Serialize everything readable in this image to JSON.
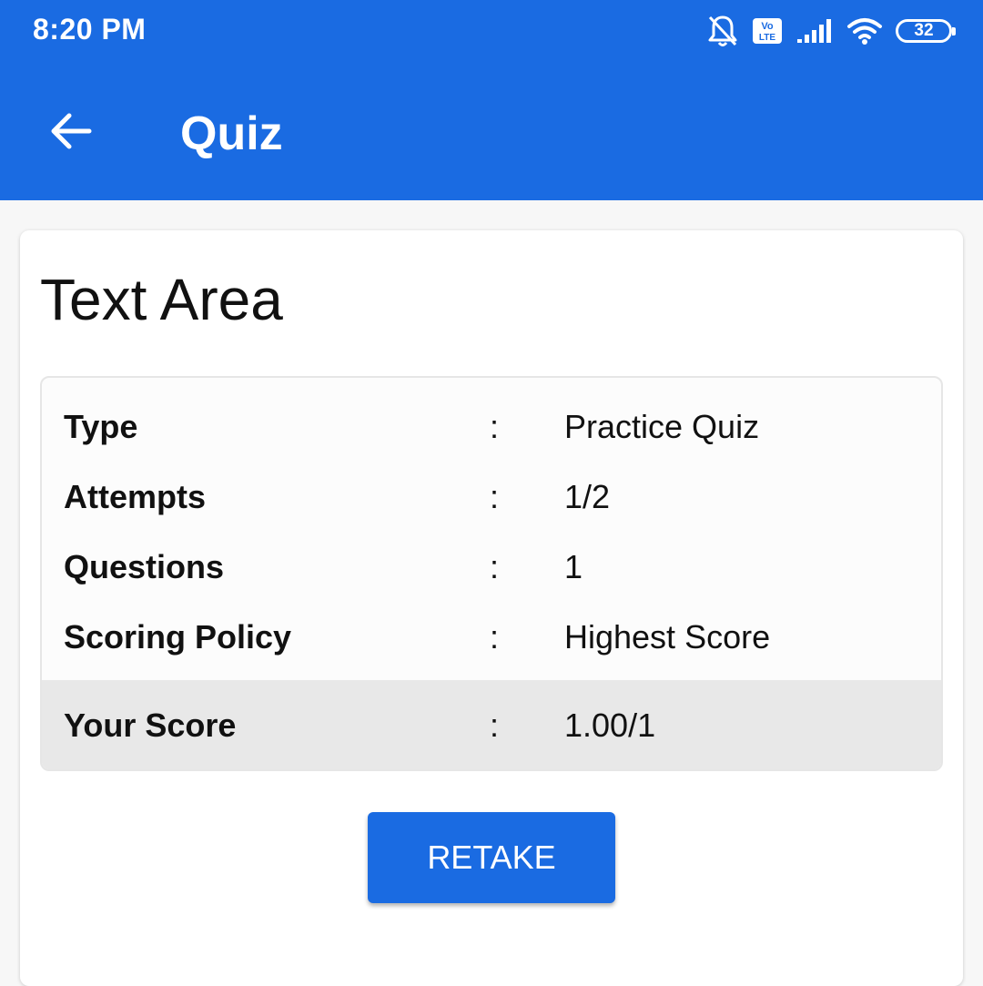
{
  "status_bar": {
    "time": "8:20 PM",
    "volte_label_top": "Vo",
    "volte_label_bottom": "LTE",
    "battery": "32",
    "icons": [
      "bell-off-icon",
      "volte-icon",
      "signal-icon",
      "wifi-icon",
      "battery-icon"
    ]
  },
  "header": {
    "title": "Quiz",
    "back_icon": "arrow-left-icon",
    "background": "#1a6be2"
  },
  "card": {
    "title": "Text Area",
    "rows": [
      {
        "label": "Type",
        "separator": ":",
        "value": "Practice Quiz"
      },
      {
        "label": "Attempts",
        "separator": ":",
        "value": "1/2"
      },
      {
        "label": "Questions",
        "separator": ":",
        "value": "1"
      },
      {
        "label": "Scoring Policy",
        "separator": ":",
        "value": "Highest Score"
      }
    ],
    "score": {
      "label": "Your Score",
      "separator": ":",
      "value": "1.00/1"
    },
    "retake_label": "RETAKE"
  }
}
